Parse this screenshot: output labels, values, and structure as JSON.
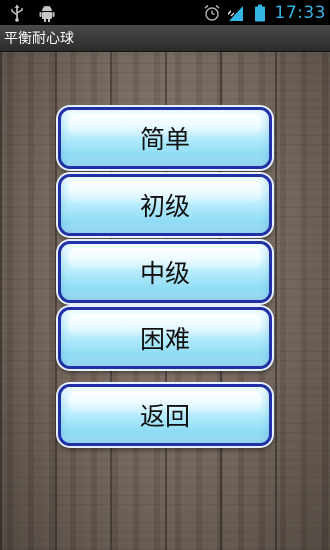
{
  "status_bar": {
    "icons_left": [
      "usb-icon",
      "android-debug-icon"
    ],
    "icons_right": [
      "alarm-icon",
      "signal-icon",
      "battery-icon"
    ],
    "time": "17:33",
    "accent_color": "#33b5e5"
  },
  "app": {
    "title": "平衡耐心球"
  },
  "menu": {
    "easy_label": "简单",
    "beginner_label": "初级",
    "intermediate_label": "中级",
    "hard_label": "困难",
    "back_label": "返回"
  }
}
